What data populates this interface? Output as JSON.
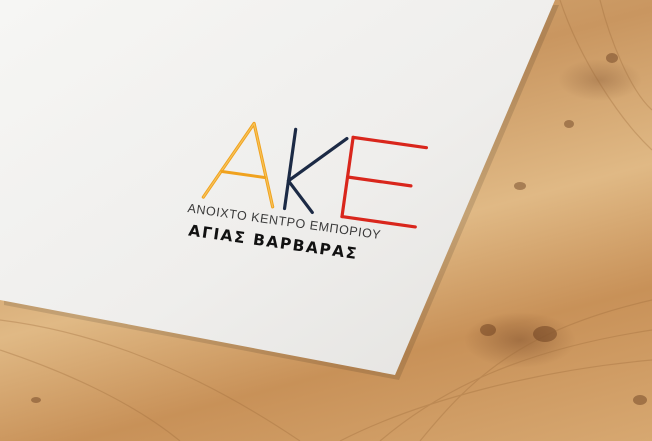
{
  "logo": {
    "mark": "AKE",
    "subtitle": "ΑΝΟΙΧΤΟ ΚΕΝΤΡΟ ΕΜΠΟΡΙΟΥ",
    "name": "ΑΓΙΑΣ ΒΑΡΒΑΡΑΣ"
  },
  "colors": {
    "paper": "#f2f1ef",
    "wood": "#d2a36c",
    "orange": "#f0a21e",
    "navy": "#1c2a45",
    "red": "#d9261c"
  }
}
